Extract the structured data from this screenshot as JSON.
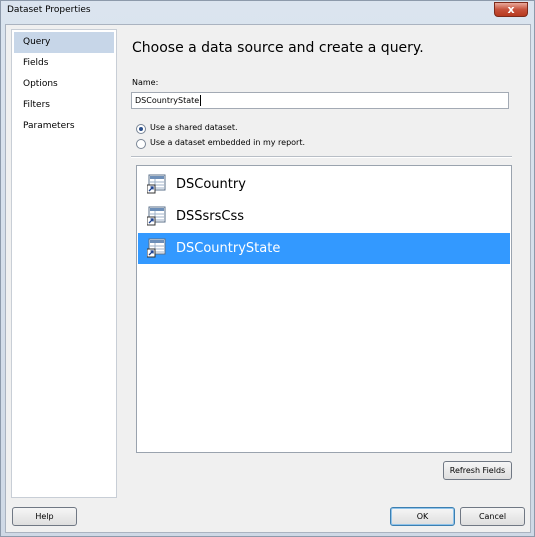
{
  "window": {
    "title": "Dataset Properties",
    "close_glyph": "x"
  },
  "nav": {
    "items": [
      {
        "label": "Query",
        "selected": true
      },
      {
        "label": "Fields",
        "selected": false
      },
      {
        "label": "Options",
        "selected": false
      },
      {
        "label": "Filters",
        "selected": false
      },
      {
        "label": "Parameters",
        "selected": false
      }
    ]
  },
  "main": {
    "heading": "Choose a data source and create a query.",
    "name_label": "Name:",
    "name_value": "DSCountryState",
    "radio_options": [
      {
        "label": "Use a shared dataset.",
        "checked": true
      },
      {
        "label": "Use a dataset embedded in my report.",
        "checked": false
      }
    ],
    "datasets": [
      {
        "label": "DSCountry",
        "selected": false,
        "icon": "shared-dataset-icon"
      },
      {
        "label": "DSSsrsCss",
        "selected": false,
        "icon": "shared-dataset-icon"
      },
      {
        "label": "DSCountryState",
        "selected": true,
        "icon": "shared-dataset-icon"
      }
    ],
    "refresh_label": "Refresh Fields"
  },
  "footer": {
    "help_label": "Help",
    "ok_label": "OK",
    "cancel_label": "Cancel"
  },
  "colors": {
    "selection": "#3399ff",
    "nav_selection": "#c7d6e8",
    "close": "#c6523c"
  }
}
